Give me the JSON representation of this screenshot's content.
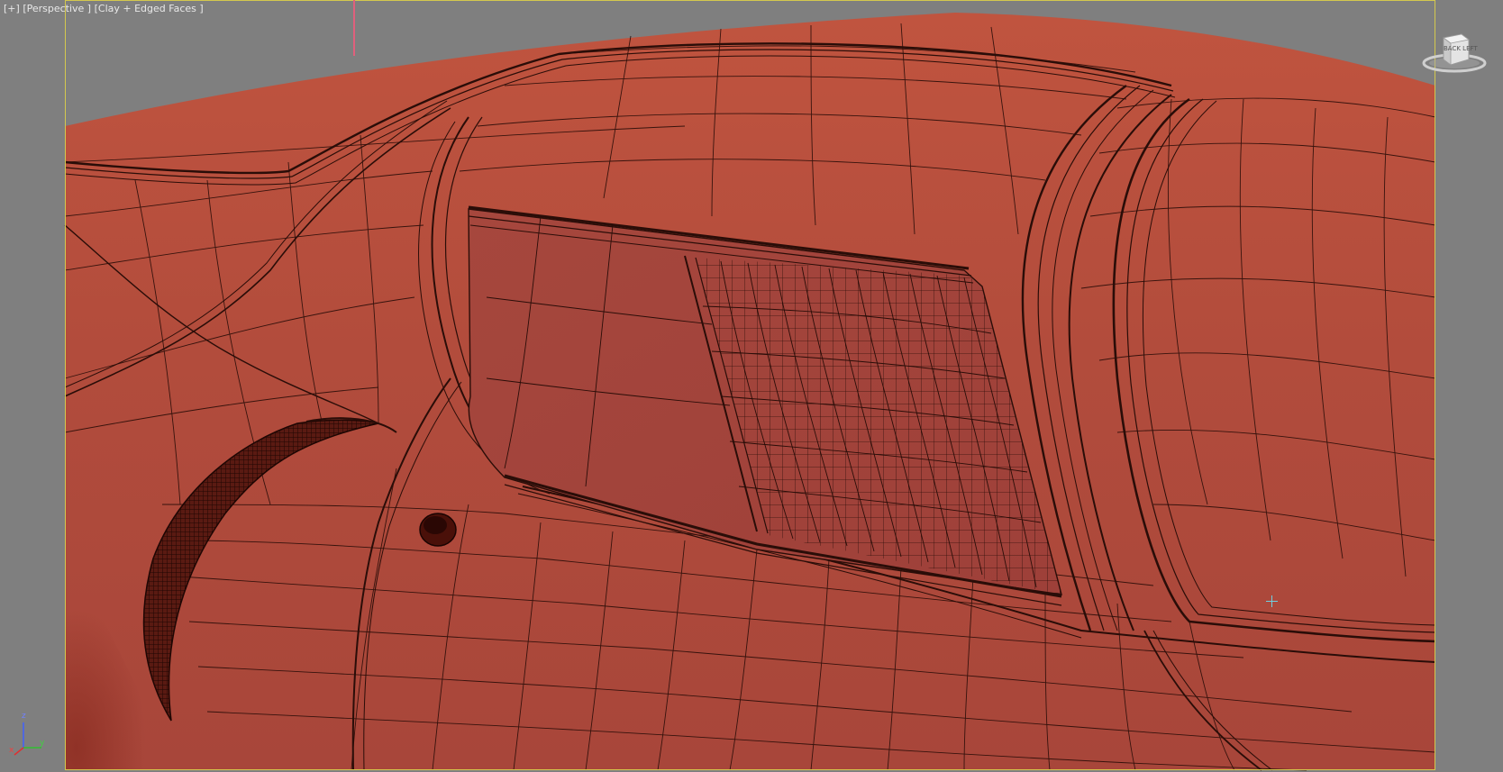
{
  "viewport": {
    "label_plus": "[+]",
    "label_view": "[Perspective ]",
    "label_shading": "[Clay + Edged Faces ]"
  },
  "viewcube": {
    "face_text": "BACK LEFT"
  },
  "axis_gizmo": {
    "x": "x",
    "y": "y",
    "z": "z"
  },
  "colors": {
    "viewport_bg": "#7f7f7f",
    "clay": "#b5503f",
    "wire": "#2a0d08",
    "safe_frame": "#d4c84e",
    "axis_x": "#e03030",
    "axis_y": "#30c030",
    "axis_z": "#4060ff"
  }
}
